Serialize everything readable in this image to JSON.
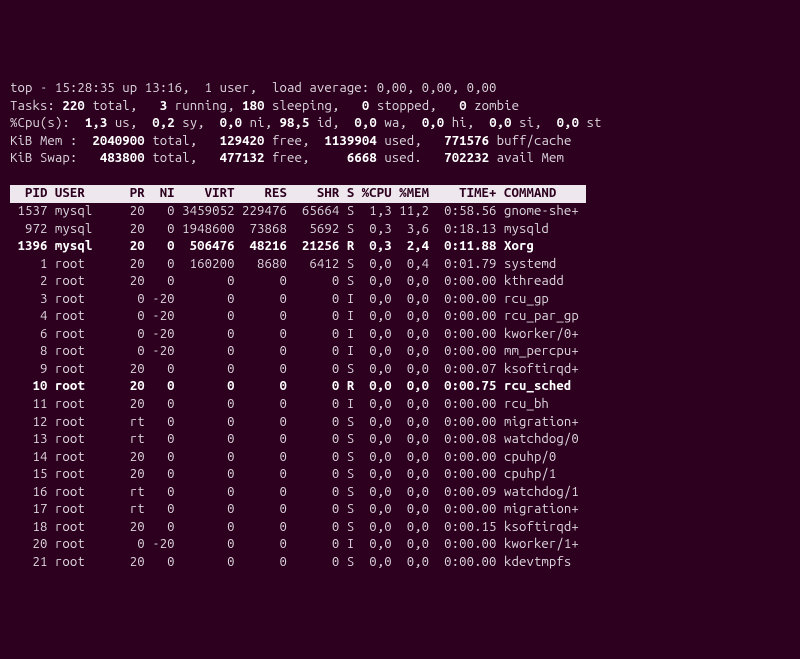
{
  "summary": {
    "line1": "top - 15:28:35 up 13:16,  1 user,  load average: 0,00, 0,00, 0,00",
    "tasks": {
      "label": "Tasks:",
      "total": "220",
      "running": "3",
      "sleeping": "180",
      "stopped": "0",
      "zombie": "0"
    },
    "cpu": {
      "label": "%Cpu(s):",
      "us": "1,3",
      "sy": "0,2",
      "ni": "0,0",
      "id": "98,5",
      "wa": "0,0",
      "hi": "0,0",
      "si": "0,0",
      "st": "0,0"
    },
    "mem": {
      "label": "KiB Mem :",
      "total": "2040900",
      "free": "129420",
      "used": "1139904",
      "buff": "771576"
    },
    "swap": {
      "label": "KiB Swap:",
      "total": "483800",
      "free": "477132",
      "used": "6668",
      "avail": "702232"
    }
  },
  "columns": [
    "PID",
    "USER",
    "PR",
    "NI",
    "VIRT",
    "RES",
    "SHR",
    "S",
    "%CPU",
    "%MEM",
    "TIME+",
    "COMMAND"
  ],
  "widths": {
    "PID": 5,
    "USER": 8,
    "PR": 4,
    "NI": 4,
    "VIRT": 8,
    "RES": 7,
    "SHR": 7,
    "S": 2,
    "%CPU": 5,
    "%MEM": 5,
    "TIME+": 9,
    "COMMAND": 11
  },
  "rows": [
    {
      "pid": "1537",
      "user": "mysql",
      "pr": "20",
      "ni": "0",
      "virt": "3459052",
      "res": "229476",
      "shr": "65664",
      "s": "S",
      "cpu": "1,3",
      "mem": "11,2",
      "time": "0:58.56",
      "cmd": "gnome-she+",
      "bold": false
    },
    {
      "pid": "972",
      "user": "mysql",
      "pr": "20",
      "ni": "0",
      "virt": "1948600",
      "res": "73868",
      "shr": "5692",
      "s": "S",
      "cpu": "0,3",
      "mem": "3,6",
      "time": "0:18.13",
      "cmd": "mysqld",
      "bold": false
    },
    {
      "pid": "1396",
      "user": "mysql",
      "pr": "20",
      "ni": "0",
      "virt": "506476",
      "res": "48216",
      "shr": "21256",
      "s": "R",
      "cpu": "0,3",
      "mem": "2,4",
      "time": "0:11.88",
      "cmd": "Xorg",
      "bold": true
    },
    {
      "pid": "1",
      "user": "root",
      "pr": "20",
      "ni": "0",
      "virt": "160200",
      "res": "8680",
      "shr": "6412",
      "s": "S",
      "cpu": "0,0",
      "mem": "0,4",
      "time": "0:01.79",
      "cmd": "systemd",
      "bold": false
    },
    {
      "pid": "2",
      "user": "root",
      "pr": "20",
      "ni": "0",
      "virt": "0",
      "res": "0",
      "shr": "0",
      "s": "S",
      "cpu": "0,0",
      "mem": "0,0",
      "time": "0:00.00",
      "cmd": "kthreadd",
      "bold": false
    },
    {
      "pid": "3",
      "user": "root",
      "pr": "0",
      "ni": "-20",
      "virt": "0",
      "res": "0",
      "shr": "0",
      "s": "I",
      "cpu": "0,0",
      "mem": "0,0",
      "time": "0:00.00",
      "cmd": "rcu_gp",
      "bold": false
    },
    {
      "pid": "4",
      "user": "root",
      "pr": "0",
      "ni": "-20",
      "virt": "0",
      "res": "0",
      "shr": "0",
      "s": "I",
      "cpu": "0,0",
      "mem": "0,0",
      "time": "0:00.00",
      "cmd": "rcu_par_gp",
      "bold": false
    },
    {
      "pid": "6",
      "user": "root",
      "pr": "0",
      "ni": "-20",
      "virt": "0",
      "res": "0",
      "shr": "0",
      "s": "I",
      "cpu": "0,0",
      "mem": "0,0",
      "time": "0:00.00",
      "cmd": "kworker/0+",
      "bold": false
    },
    {
      "pid": "8",
      "user": "root",
      "pr": "0",
      "ni": "-20",
      "virt": "0",
      "res": "0",
      "shr": "0",
      "s": "I",
      "cpu": "0,0",
      "mem": "0,0",
      "time": "0:00.00",
      "cmd": "mm_percpu+",
      "bold": false
    },
    {
      "pid": "9",
      "user": "root",
      "pr": "20",
      "ni": "0",
      "virt": "0",
      "res": "0",
      "shr": "0",
      "s": "S",
      "cpu": "0,0",
      "mem": "0,0",
      "time": "0:00.07",
      "cmd": "ksoftirqd+",
      "bold": false
    },
    {
      "pid": "10",
      "user": "root",
      "pr": "20",
      "ni": "0",
      "virt": "0",
      "res": "0",
      "shr": "0",
      "s": "R",
      "cpu": "0,0",
      "mem": "0,0",
      "time": "0:00.75",
      "cmd": "rcu_sched",
      "bold": true
    },
    {
      "pid": "11",
      "user": "root",
      "pr": "20",
      "ni": "0",
      "virt": "0",
      "res": "0",
      "shr": "0",
      "s": "I",
      "cpu": "0,0",
      "mem": "0,0",
      "time": "0:00.00",
      "cmd": "rcu_bh",
      "bold": false
    },
    {
      "pid": "12",
      "user": "root",
      "pr": "rt",
      "ni": "0",
      "virt": "0",
      "res": "0",
      "shr": "0",
      "s": "S",
      "cpu": "0,0",
      "mem": "0,0",
      "time": "0:00.00",
      "cmd": "migration+",
      "bold": false
    },
    {
      "pid": "13",
      "user": "root",
      "pr": "rt",
      "ni": "0",
      "virt": "0",
      "res": "0",
      "shr": "0",
      "s": "S",
      "cpu": "0,0",
      "mem": "0,0",
      "time": "0:00.08",
      "cmd": "watchdog/0",
      "bold": false
    },
    {
      "pid": "14",
      "user": "root",
      "pr": "20",
      "ni": "0",
      "virt": "0",
      "res": "0",
      "shr": "0",
      "s": "S",
      "cpu": "0,0",
      "mem": "0,0",
      "time": "0:00.00",
      "cmd": "cpuhp/0",
      "bold": false
    },
    {
      "pid": "15",
      "user": "root",
      "pr": "20",
      "ni": "0",
      "virt": "0",
      "res": "0",
      "shr": "0",
      "s": "S",
      "cpu": "0,0",
      "mem": "0,0",
      "time": "0:00.00",
      "cmd": "cpuhp/1",
      "bold": false
    },
    {
      "pid": "16",
      "user": "root",
      "pr": "rt",
      "ni": "0",
      "virt": "0",
      "res": "0",
      "shr": "0",
      "s": "S",
      "cpu": "0,0",
      "mem": "0,0",
      "time": "0:00.09",
      "cmd": "watchdog/1",
      "bold": false
    },
    {
      "pid": "17",
      "user": "root",
      "pr": "rt",
      "ni": "0",
      "virt": "0",
      "res": "0",
      "shr": "0",
      "s": "S",
      "cpu": "0,0",
      "mem": "0,0",
      "time": "0:00.00",
      "cmd": "migration+",
      "bold": false
    },
    {
      "pid": "18",
      "user": "root",
      "pr": "20",
      "ni": "0",
      "virt": "0",
      "res": "0",
      "shr": "0",
      "s": "S",
      "cpu": "0,0",
      "mem": "0,0",
      "time": "0:00.15",
      "cmd": "ksoftirqd+",
      "bold": false
    },
    {
      "pid": "20",
      "user": "root",
      "pr": "0",
      "ni": "-20",
      "virt": "0",
      "res": "0",
      "shr": "0",
      "s": "I",
      "cpu": "0,0",
      "mem": "0,0",
      "time": "0:00.00",
      "cmd": "kworker/1+",
      "bold": false
    },
    {
      "pid": "21",
      "user": "root",
      "pr": "20",
      "ni": "0",
      "virt": "0",
      "res": "0",
      "shr": "0",
      "s": "S",
      "cpu": "0,0",
      "mem": "0,0",
      "time": "0:00.00",
      "cmd": "kdevtmpfs",
      "bold": false
    }
  ]
}
